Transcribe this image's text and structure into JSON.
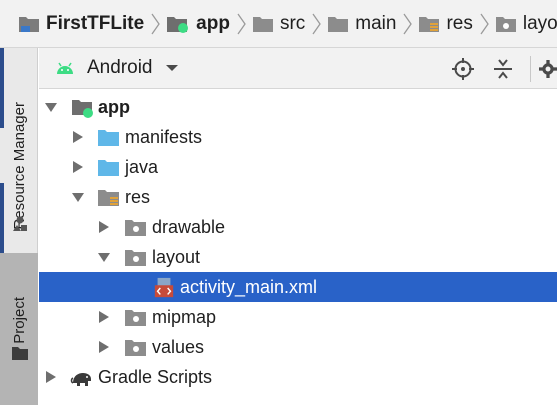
{
  "breadcrumb": {
    "items": [
      {
        "label": "FirstTFLite"
      },
      {
        "label": "app"
      },
      {
        "label": "src"
      },
      {
        "label": "main"
      },
      {
        "label": "res"
      },
      {
        "label": "layout"
      }
    ]
  },
  "left_strip": {
    "resource_manager_label": "Resource Manager",
    "project_label": "1: Project"
  },
  "toolbar": {
    "view_label": "Android",
    "icons": [
      "android-icon",
      "chevron-down-icon",
      "locate-icon",
      "collapse-all-icon",
      "gear-icon"
    ]
  },
  "tree": {
    "app_label": "app",
    "manifests_label": "manifests",
    "java_label": "java",
    "res_label": "res",
    "drawable_label": "drawable",
    "layout_label": "layout",
    "activity_main_label": "activity_main.xml",
    "mipmap_label": "mipmap",
    "values_label": "values",
    "gradle_label": "Gradle Scripts",
    "selected": "activity_main.xml"
  },
  "colors": {
    "selection": "#2962c8",
    "android_green": "#3ddc84",
    "folder_gray": "#8c8c8c",
    "folder_blue": "#5fb7e8",
    "accent_strip": "#2c4d8c"
  }
}
